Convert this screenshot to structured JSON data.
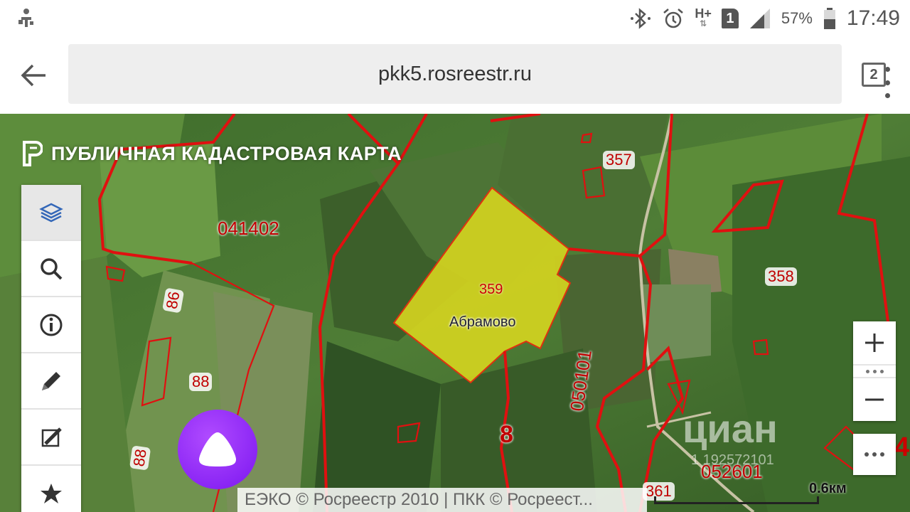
{
  "status_bar": {
    "battery_percent": "57%",
    "time": "17:49",
    "sim_slot": "1",
    "network": "H+",
    "icons": [
      "usb-debug-icon",
      "bluetooth-icon",
      "alarm-icon",
      "network-h-plus-icon",
      "sim-icon",
      "signal-icon",
      "battery-icon"
    ]
  },
  "browser": {
    "url": "pkk5.rosreestr.ru",
    "tab_count": "2"
  },
  "map": {
    "title": "ПУБЛИЧНАЯ КАДАСТРОВАЯ КАРТА",
    "toolbar_icons": [
      "layers-icon",
      "search-icon",
      "info-icon",
      "pencil-icon",
      "measure-icon",
      "star-icon"
    ],
    "labels": {
      "q1": "041402",
      "q2": "050101",
      "q3": "052601",
      "n357": "357",
      "n358": "358",
      "n359": "359",
      "n86": "86",
      "n88a": "88",
      "n88b": "88",
      "n8": "8",
      "n361": "361",
      "edge": "4"
    },
    "village": "Абрамово",
    "attribution": "ЕЭКО © Росреестр 2010 | ПКК © Росреест...",
    "scale": "0.6км",
    "watermark": "циан",
    "watermark_id": "1 192572101",
    "colors": {
      "parcel_fill": "#d6d51f",
      "boundary": "#e01010"
    }
  }
}
